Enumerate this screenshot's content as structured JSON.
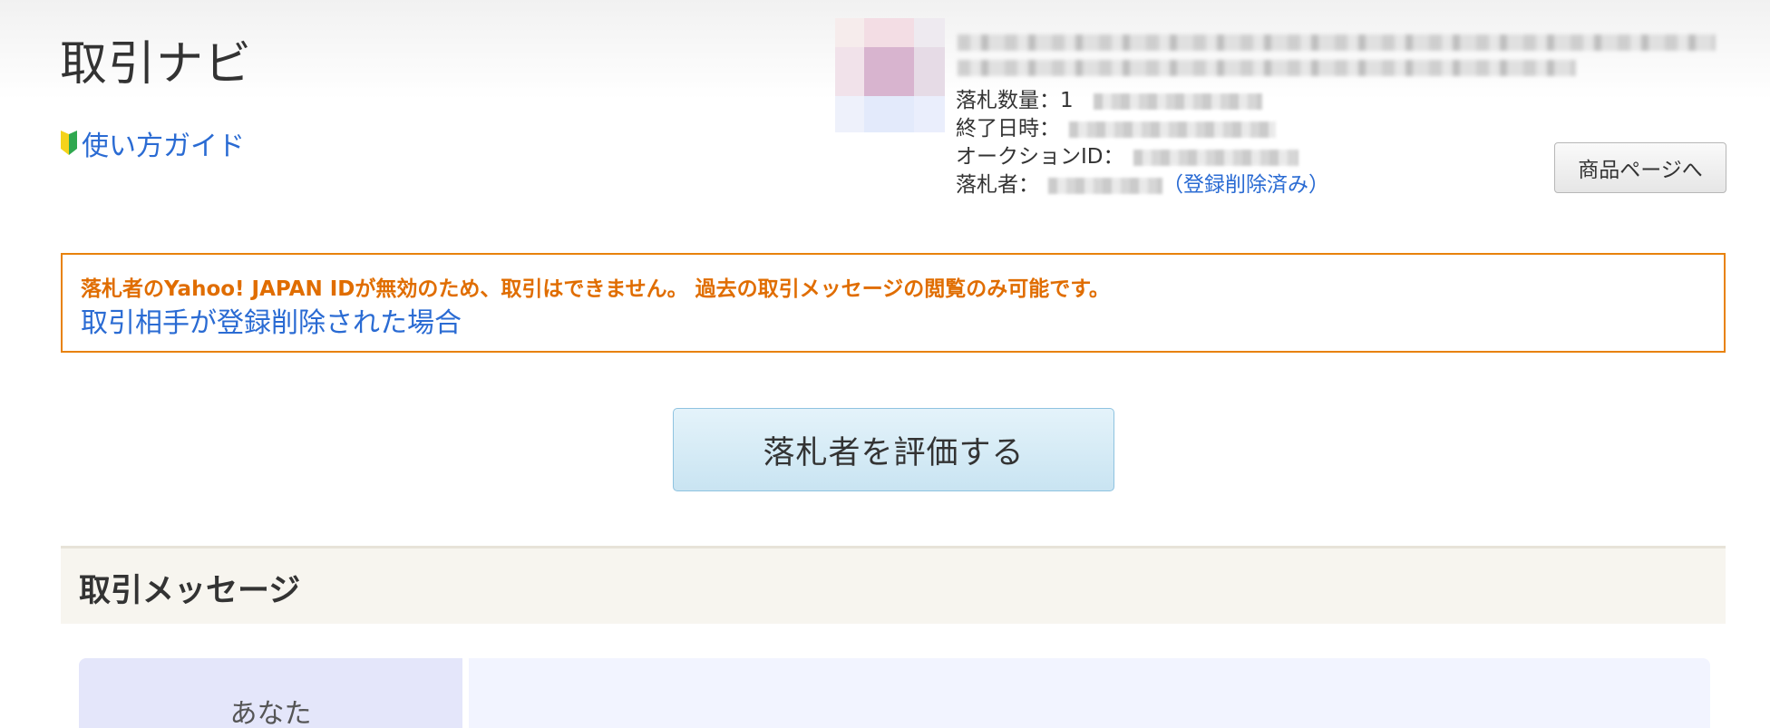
{
  "header": {
    "title": "取引ナビ",
    "guide_link": "使い方ガイド"
  },
  "item": {
    "quantity_label": "落札数量：",
    "quantity_value": "1",
    "end_date_label": "終了日時：",
    "auction_id_label": "オークションID：",
    "winner_label": "落札者：",
    "winner_status": "（登録削除済み）",
    "product_page_button": "商品ページへ"
  },
  "alert": {
    "message": "落札者のYahoo! JAPAN IDが無効のため、取引はできません。 過去の取引メッセージの閲覧のみ可能です。",
    "link": "取引相手が登録削除された場合"
  },
  "actions": {
    "rate_winner_button": "落札者を評価する"
  },
  "messages": {
    "section_title": "取引メッセージ",
    "author_label": "あなた"
  },
  "colors": {
    "alert_border": "#e8820c",
    "alert_text": "#e06d00",
    "link": "#2a6bd3",
    "rate_button": "#d3eaf5"
  }
}
